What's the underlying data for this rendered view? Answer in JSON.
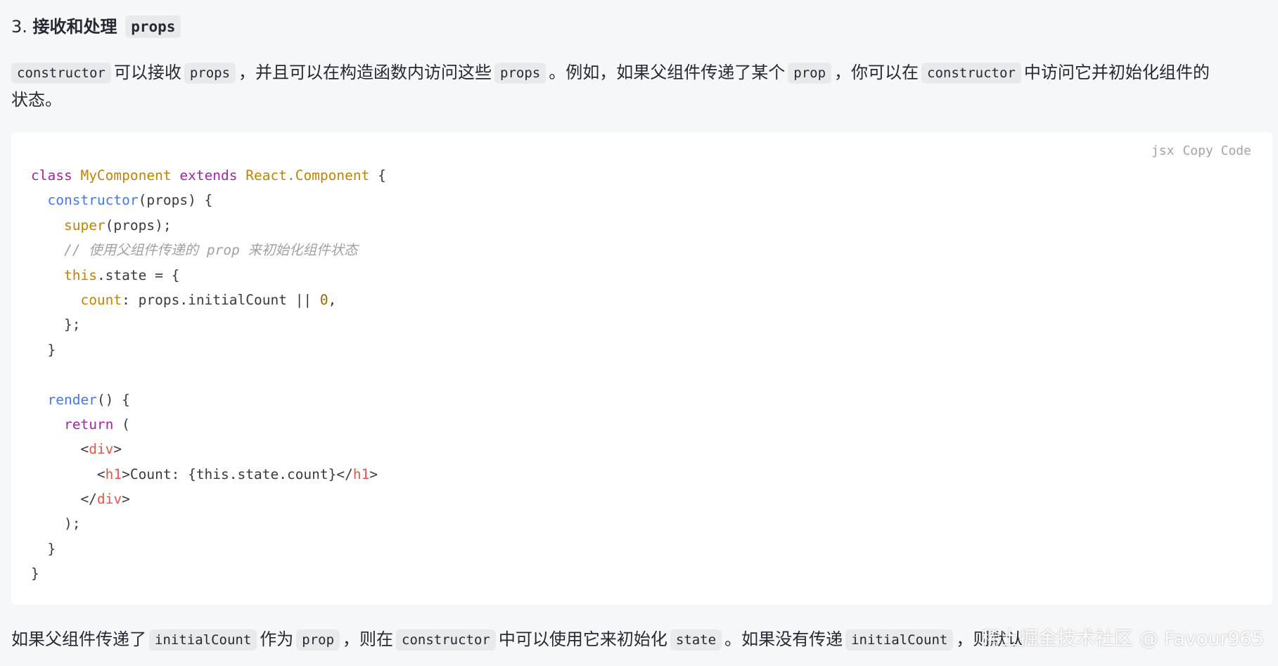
{
  "heading": {
    "number": "3.",
    "text": "接收和处理",
    "code": "props"
  },
  "paragraph1": {
    "code1": "constructor",
    "t1": "可以接收",
    "code2": "props",
    "t2": "，并且可以在构造函数内访问这些",
    "code3": "props",
    "t3": "。例如，如果父组件传递了某个",
    "code4": "prop",
    "t4": "，你可以在",
    "code5": "constructor",
    "t5": "中访问它并初始化组件的",
    "t6": "状态。"
  },
  "code_block": {
    "language": "jsx",
    "copy_label": "Copy Code",
    "lines": [
      [
        {
          "t": "kw",
          "v": "class "
        },
        {
          "t": "cls",
          "v": "MyComponent "
        },
        {
          "t": "kw",
          "v": "extends "
        },
        {
          "t": "cls",
          "v": "React.Component"
        },
        {
          "t": "",
          "v": " {"
        }
      ],
      [
        {
          "t": "",
          "v": "  "
        },
        {
          "t": "fn",
          "v": "constructor"
        },
        {
          "t": "",
          "v": "(props) {"
        }
      ],
      [
        {
          "t": "",
          "v": "    "
        },
        {
          "t": "cls",
          "v": "super"
        },
        {
          "t": "",
          "v": "(props);"
        }
      ],
      [
        {
          "t": "cm",
          "v": "    // 使用父组件传递的 prop 来初始化组件状态"
        }
      ],
      [
        {
          "t": "",
          "v": "    "
        },
        {
          "t": "cls",
          "v": "this"
        },
        {
          "t": "",
          "v": ".state = {"
        }
      ],
      [
        {
          "t": "",
          "v": "      "
        },
        {
          "t": "cls",
          "v": "count"
        },
        {
          "t": "",
          "v": ": props.initialCount || "
        },
        {
          "t": "n0",
          "v": "0"
        },
        {
          "t": "",
          "v": ","
        }
      ],
      [
        {
          "t": "",
          "v": "    };"
        }
      ],
      [
        {
          "t": "",
          "v": "  }"
        }
      ],
      [
        {
          "t": "",
          "v": ""
        }
      ],
      [
        {
          "t": "",
          "v": "  "
        },
        {
          "t": "fn",
          "v": "render"
        },
        {
          "t": "",
          "v": "() {"
        }
      ],
      [
        {
          "t": "",
          "v": "    "
        },
        {
          "t": "kw",
          "v": "return"
        },
        {
          "t": "",
          "v": " ("
        }
      ],
      [
        {
          "t": "",
          "v": "      <"
        },
        {
          "t": "tag",
          "v": "div"
        },
        {
          "t": "",
          "v": ">"
        }
      ],
      [
        {
          "t": "",
          "v": "        <"
        },
        {
          "t": "tag",
          "v": "h1"
        },
        {
          "t": "",
          "v": ">Count: {this.state.count}</"
        },
        {
          "t": "tag",
          "v": "h1"
        },
        {
          "t": "",
          "v": ">"
        }
      ],
      [
        {
          "t": "",
          "v": "      </"
        },
        {
          "t": "tag",
          "v": "div"
        },
        {
          "t": "",
          "v": ">"
        }
      ],
      [
        {
          "t": "",
          "v": "    );"
        }
      ],
      [
        {
          "t": "",
          "v": "  }"
        }
      ],
      [
        {
          "t": "",
          "v": "}"
        }
      ]
    ]
  },
  "paragraph2": {
    "t1": "如果父组件传递了",
    "code1": "initialCount",
    "t2": "作为",
    "code2": "prop",
    "t3": "，则在",
    "code3": "constructor",
    "t4": "中可以使用它来初始化",
    "code4": "state",
    "t5": "。如果没有传递",
    "code5": "initialCount",
    "t6": "，则默认"
  },
  "watermark": "稀土掘金技术社区 @ Favour965"
}
